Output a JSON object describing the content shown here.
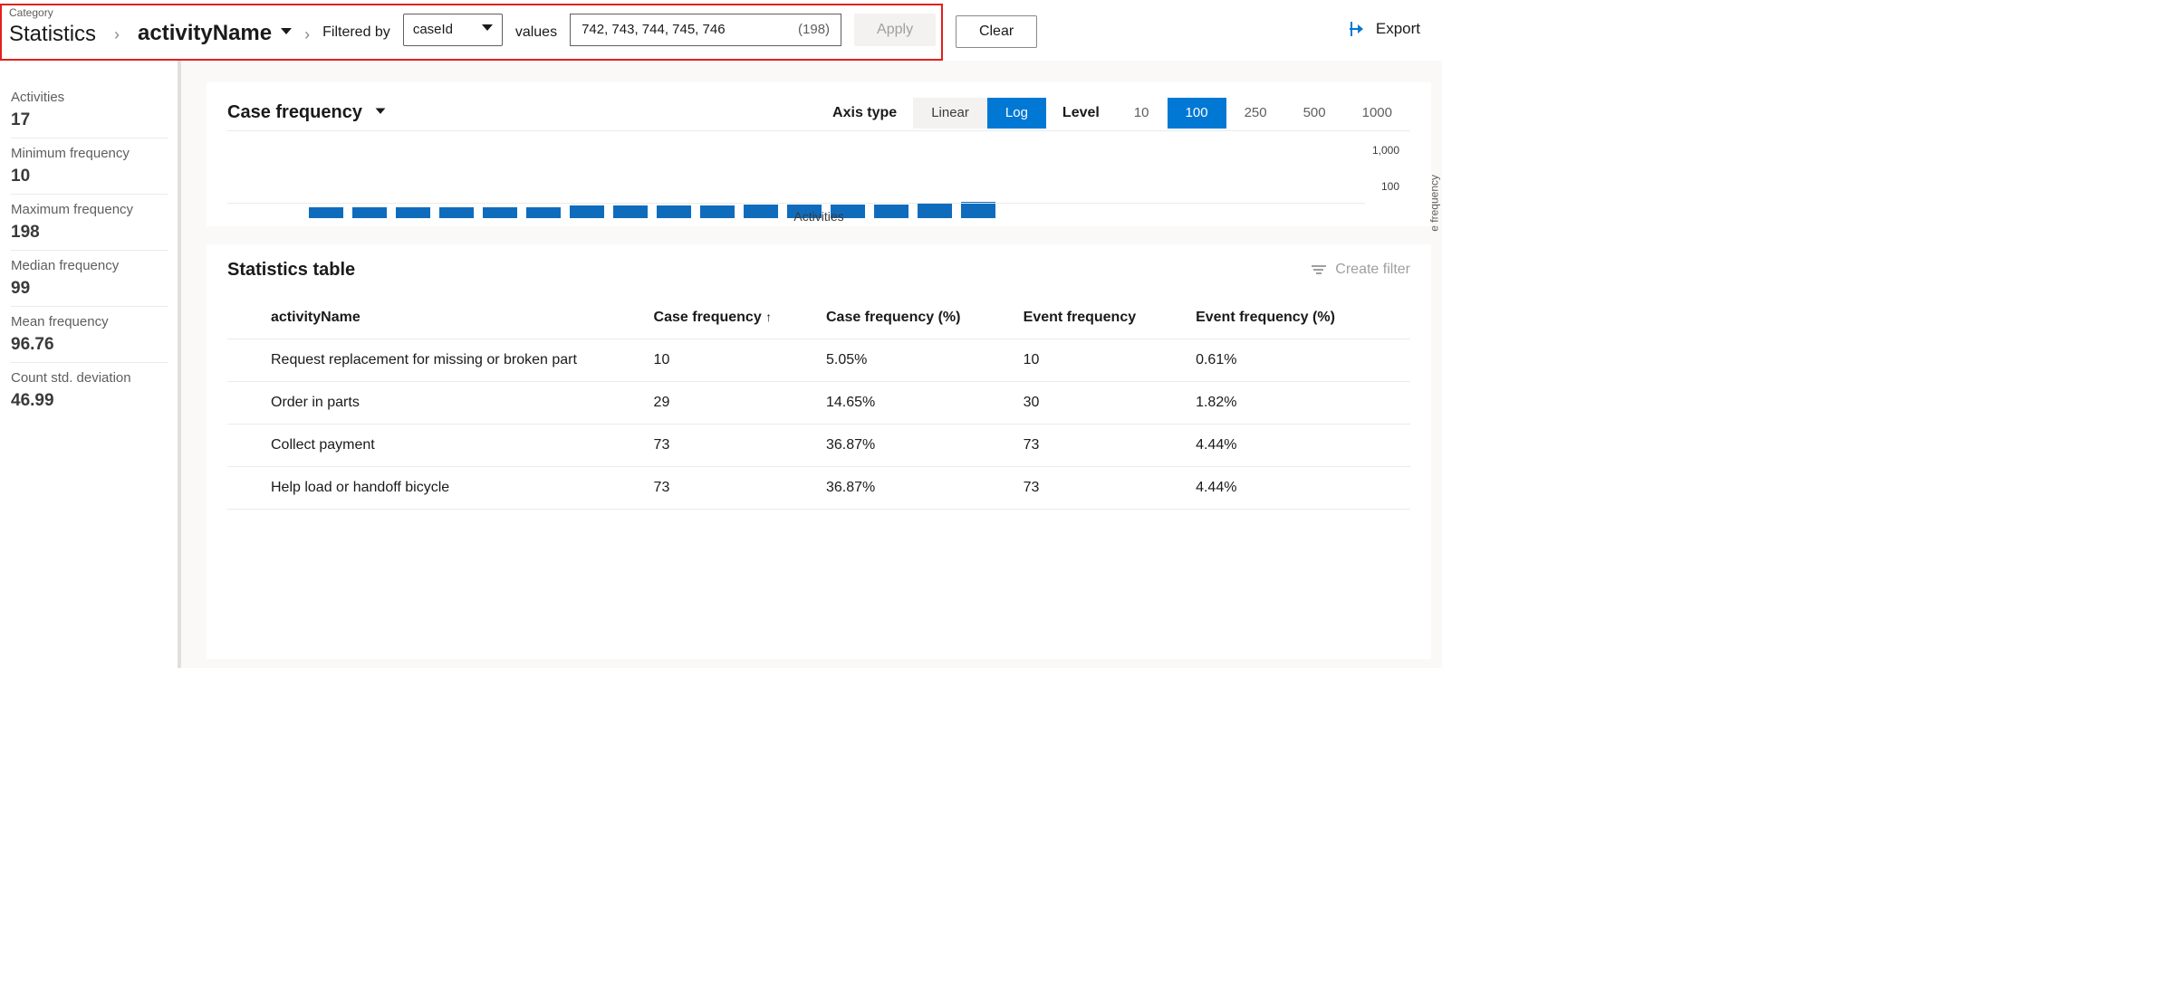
{
  "topbar": {
    "category_label": "Category",
    "category_value": "Statistics",
    "activity_name": "activityName",
    "filtered_by_label": "Filtered by",
    "filter_field": "caseId",
    "values_label": "values",
    "values_text": "742, 743, 744, 745, 746",
    "values_count": "(198)",
    "apply_label": "Apply",
    "clear_label": "Clear",
    "export_label": "Export"
  },
  "sidebar": {
    "items": [
      {
        "label": "Activities",
        "value": "17"
      },
      {
        "label": "Minimum frequency",
        "value": "10"
      },
      {
        "label": "Maximum frequency",
        "value": "198"
      },
      {
        "label": "Median frequency",
        "value": "99"
      },
      {
        "label": "Mean frequency",
        "value": "96.76"
      },
      {
        "label": "Count std. deviation",
        "value": "46.99"
      }
    ]
  },
  "chart": {
    "title": "Case frequency",
    "axis_type_label": "Axis type",
    "axis_type_options": [
      "Linear",
      "Log"
    ],
    "axis_type_selected": "Log",
    "level_label": "Level",
    "level_options": [
      "10",
      "100",
      "250",
      "500",
      "1000"
    ],
    "level_selected": "100",
    "x_label": "Activities",
    "y_label": "e frequency",
    "y_ticks": [
      "1,000",
      "100"
    ]
  },
  "table": {
    "title": "Statistics table",
    "create_filter_label": "Create filter",
    "columns": [
      "activityName",
      "Case frequency",
      "Case frequency (%)",
      "Event frequency",
      "Event frequency (%)"
    ],
    "sort_indicator": "↑",
    "rows": [
      {
        "activityName": "Request replacement for missing or broken part",
        "cf": "10",
        "cfp": "5.05%",
        "ef": "10",
        "efp": "0.61%"
      },
      {
        "activityName": "Order in parts",
        "cf": "29",
        "cfp": "14.65%",
        "ef": "30",
        "efp": "1.82%"
      },
      {
        "activityName": "Collect payment",
        "cf": "73",
        "cfp": "36.87%",
        "ef": "73",
        "efp": "4.44%"
      },
      {
        "activityName": "Help load or handoff bicycle",
        "cf": "73",
        "cfp": "36.87%",
        "ef": "73",
        "efp": "4.44%"
      }
    ]
  },
  "chart_data": {
    "type": "bar",
    "title": "Case frequency",
    "xlabel": "Activities",
    "ylabel": "frequency",
    "yscale": "log",
    "ylim": [
      10,
      1000
    ],
    "yticks": [
      100,
      1000
    ],
    "note": "x categories are unlabeled activities; heights estimated from log axis",
    "values": [
      60,
      60,
      60,
      60,
      60,
      60,
      80,
      80,
      85,
      85,
      90,
      90,
      95,
      100,
      130,
      140
    ]
  }
}
